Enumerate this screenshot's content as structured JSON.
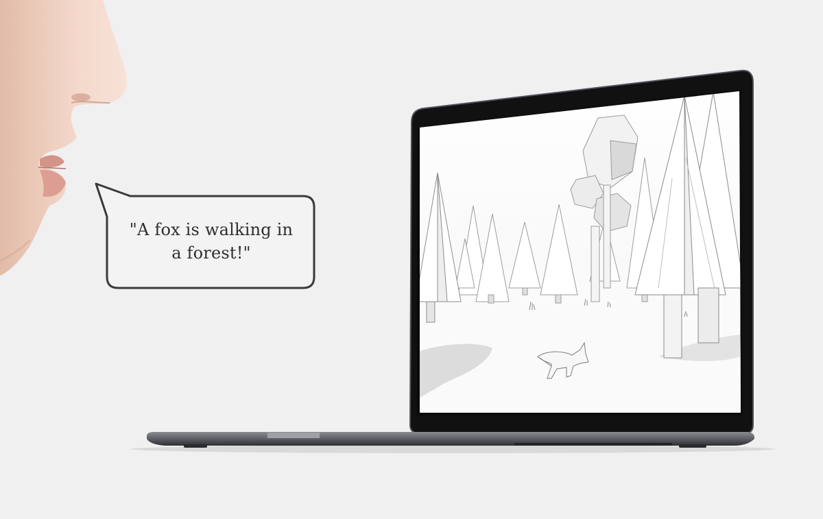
{
  "speech_bubble": {
    "line1": "\"A fox is walking in",
    "line2": "a forest!\""
  },
  "colors": {
    "background": "#f0f0f0",
    "skin": "#f0d2c4",
    "laptop_bezel": "#121212",
    "laptop_body": "#6c6e73",
    "screen_scene": "#f7f7f7",
    "bubble_stroke": "#3a3a3a"
  },
  "icons": {
    "face": "face-profile-icon",
    "fox": "fox-icon",
    "tree": "pine-tree-icon"
  }
}
